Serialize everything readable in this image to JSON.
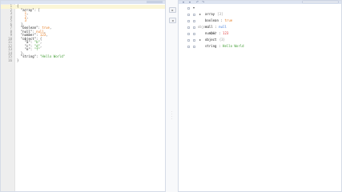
{
  "editor": {
    "lines": [
      {
        "num": "1",
        "parts": [
          {
            "t": "{",
            "c": "p"
          }
        ]
      },
      {
        "num": "2",
        "parts": [
          {
            "t": "  \"array\"",
            "c": "k"
          },
          {
            "t": ": [",
            "c": "p"
          }
        ]
      },
      {
        "num": "3",
        "parts": [
          {
            "t": "    1",
            "c": "n"
          },
          {
            "t": ",",
            "c": "p"
          }
        ]
      },
      {
        "num": "4",
        "parts": [
          {
            "t": "    2",
            "c": "n"
          },
          {
            "t": ",",
            "c": "p"
          }
        ]
      },
      {
        "num": "5",
        "parts": [
          {
            "t": "    3",
            "c": "n"
          }
        ]
      },
      {
        "num": "6",
        "parts": [
          {
            "t": "  ],",
            "c": "p"
          }
        ]
      },
      {
        "num": "7",
        "parts": [
          {
            "t": "  \"boolean\"",
            "c": "k"
          },
          {
            "t": ": ",
            "c": "p"
          },
          {
            "t": "true",
            "c": "b"
          },
          {
            "t": ",",
            "c": "p"
          }
        ]
      },
      {
        "num": "8",
        "parts": [
          {
            "t": "  \"null\"",
            "c": "k"
          },
          {
            "t": ": ",
            "c": "p"
          },
          {
            "t": "null",
            "c": "nl"
          },
          {
            "t": ",",
            "c": "p"
          }
        ]
      },
      {
        "num": "9",
        "parts": [
          {
            "t": "  \"number\"",
            "c": "k"
          },
          {
            "t": ": ",
            "c": "p"
          },
          {
            "t": "123",
            "c": "n"
          },
          {
            "t": ",",
            "c": "p"
          }
        ]
      },
      {
        "num": "10",
        "parts": [
          {
            "t": "  \"object\"",
            "c": "k"
          },
          {
            "t": ": {",
            "c": "p"
          }
        ]
      },
      {
        "num": "11",
        "parts": [
          {
            "t": "    \"a\"",
            "c": "k"
          },
          {
            "t": ": ",
            "c": "p"
          },
          {
            "t": "\"b\"",
            "c": "s"
          },
          {
            "t": ",",
            "c": "p"
          }
        ]
      },
      {
        "num": "12",
        "parts": [
          {
            "t": "    \"c\"",
            "c": "k"
          },
          {
            "t": ": ",
            "c": "p"
          },
          {
            "t": "\"d\"",
            "c": "s"
          },
          {
            "t": ",",
            "c": "p"
          }
        ]
      },
      {
        "num": "13",
        "parts": [
          {
            "t": "    \"e\"",
            "c": "k"
          },
          {
            "t": ": ",
            "c": "p"
          },
          {
            "t": "\"f\"",
            "c": "s"
          }
        ]
      },
      {
        "num": "14",
        "parts": [
          {
            "t": "  },",
            "c": "p"
          }
        ]
      },
      {
        "num": "15",
        "parts": [
          {
            "t": "  \"string\"",
            "c": "k"
          },
          {
            "t": ": ",
            "c": "p"
          },
          {
            "t": "\"Hello World\"",
            "c": "s"
          }
        ]
      },
      {
        "num": "16",
        "parts": [
          {
            "t": "}",
            "c": "p"
          }
        ]
      }
    ]
  },
  "transfer": {
    "to_right_label": "▸",
    "to_left_label": "◂"
  },
  "tree": {
    "root": {
      "key": "object",
      "count": "{6}"
    },
    "rows": [
      {
        "key": "array",
        "sep": "",
        "value": "[3]",
        "color": "gray",
        "expandable": true
      },
      {
        "key": "boolean",
        "sep": " : ",
        "value": "true",
        "color": "#e67a1e",
        "expandable": false
      },
      {
        "key": "null",
        "sep": " : ",
        "value": "null",
        "color": "#2d6fd6",
        "expandable": false
      },
      {
        "key": "number",
        "sep": " : ",
        "value": "123",
        "color": "#e03b3b",
        "expandable": false
      },
      {
        "key": "object",
        "sep": "",
        "value": "{3}",
        "color": "gray",
        "expandable": true
      },
      {
        "key": "string",
        "sep": " : ",
        "value": "Hello World",
        "color": "#3c9a2e",
        "expandable": false
      }
    ]
  },
  "toolbar_icons": [
    "filter-icon",
    "sort-icon",
    "undo-icon",
    "redo-icon"
  ]
}
